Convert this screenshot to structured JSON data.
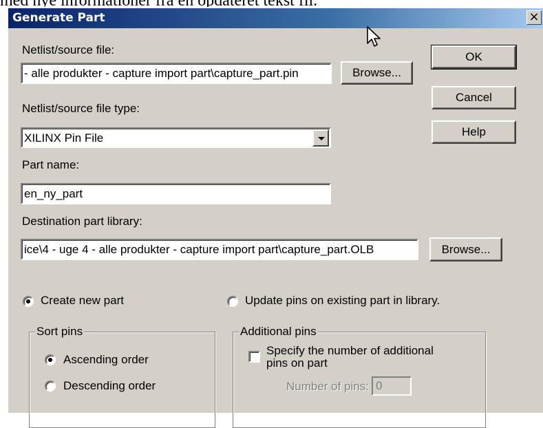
{
  "doc_fragment": "med nye informationer fra en opdateret tekst fil.",
  "window": {
    "title": "Generate Part",
    "close_label": "×"
  },
  "netlist": {
    "label": "Netlist/source file:",
    "value": "- alle produkter - capture import part\\capture_part.pin",
    "browse_label": "Browse..."
  },
  "netlist_type": {
    "label": "Netlist/source file type:",
    "selected": "XILINX Pin File"
  },
  "part_name": {
    "label": "Part name:",
    "value": "en_ny_part"
  },
  "destination": {
    "label": "Destination part library:",
    "value": "ice\\4 - uge 4 - alle produkter - capture import part\\capture_part.OLB",
    "browse_label": "Browse..."
  },
  "buttons": {
    "ok": "OK",
    "cancel": "Cancel",
    "help": "Help"
  },
  "mode": {
    "create_label": "Create new part",
    "update_label": "Update pins on existing part in library.",
    "selected": "create"
  },
  "sort_pins": {
    "title": "Sort pins",
    "ascending": "Ascending order",
    "descending": "Descending order",
    "selected": "ascending"
  },
  "additional_pins": {
    "title": "Additional pins",
    "checkbox_label_line1": "Specify the number of additional",
    "checkbox_label_line2": "pins on part",
    "checked": false,
    "number_label": "Number of pins:",
    "number_value": "0"
  }
}
